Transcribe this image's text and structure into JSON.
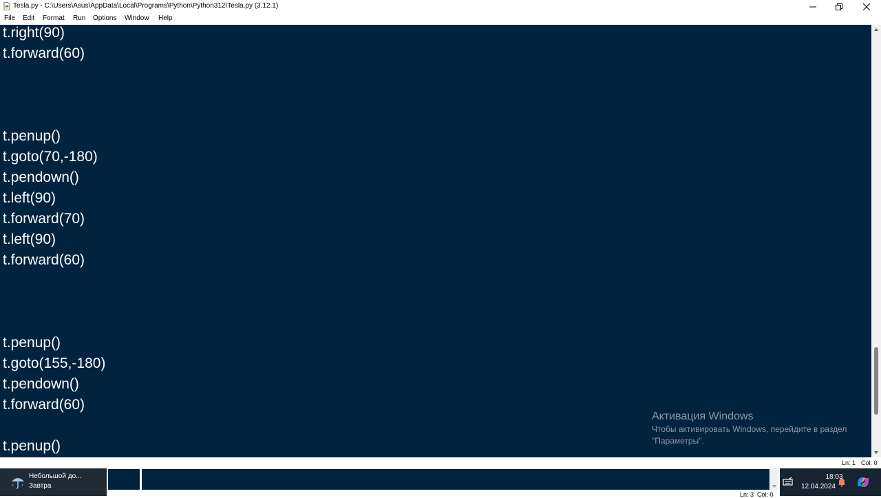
{
  "window": {
    "title": "Tesla.py - C:\\Users\\Asus\\AppData\\Local\\Programs\\Python\\Python312\\Tesla.py (3.12.1)",
    "icons": [
      "python-file-icon",
      "minimize-icon",
      "maximize-icon",
      "close-icon"
    ]
  },
  "menu": [
    "File",
    "Edit",
    "Format",
    "Run",
    "Options",
    "Window",
    "Help"
  ],
  "editor": {
    "background": "#00233f",
    "text_color": "#ffffff",
    "lines": [
      "t.right(90)",
      "t.forward(60)",
      "",
      "",
      "",
      "t.penup()",
      "t.goto(70,-180)",
      "t.pendown()",
      "t.left(90)",
      "t.forward(70)",
      "t.left(90)",
      "t.forward(60)",
      "",
      "",
      "",
      "t.penup()",
      "t.goto(155,-180)",
      "t.pendown()",
      "t.forward(60)",
      "",
      "t.penup()"
    ]
  },
  "watermark": {
    "title": "Активация Windows",
    "line1": "Чтобы активировать Windows, перейдите в раздел",
    "line2": "\"Параметры\"."
  },
  "status": {
    "ln": "Ln: 1",
    "col": "Col: 0"
  },
  "embedded_status": {
    "ln": "Ln: 3",
    "col": "Col: 0"
  },
  "taskbar": {
    "weather_title": "Небольшой до...",
    "weather_sub": "Завтра",
    "time": "18:03",
    "date": "12.04.2024",
    "tray_icons": [
      "keyboard-icon",
      "notification-bell-icon",
      "copilot-icon"
    ]
  }
}
